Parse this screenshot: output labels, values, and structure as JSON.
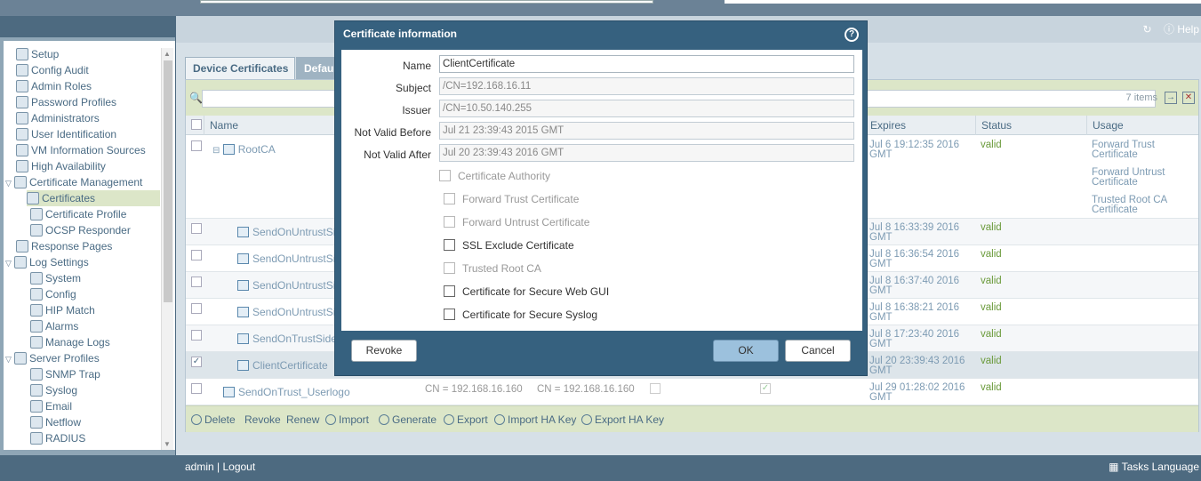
{
  "modal": {
    "title": "Certificate information",
    "fields": [
      {
        "label": "Name",
        "value": "ClientCertificate"
      },
      {
        "label": "Subject",
        "value": "/CN=192.168.16.11"
      },
      {
        "label": "Issuer",
        "value": "/CN=10.50.140.255"
      },
      {
        "label": "Not Valid Before",
        "value": "Jul 21 23:39:43 2015 GMT"
      },
      {
        "label": "Not Valid After",
        "value": "Jul 20 23:39:43 2016 GMT"
      }
    ],
    "checkboxes": [
      "Certificate Authority",
      "Forward Trust Certificate",
      "Forward Untrust Certificate",
      "SSL Exclude Certificate",
      "Trusted Root CA",
      "Certificate for Secure Web GUI",
      "Certificate for Secure Syslog"
    ],
    "revoke_label": "Revoke",
    "ok_label": "OK",
    "cancel_label": "Cancel"
  },
  "header": {
    "help_label": "Help"
  },
  "tabs": {
    "device": "Device Certificates",
    "default": "Defau"
  },
  "grid": {
    "count": "7 items",
    "headers": {
      "name": "Name",
      "expires": "Expires",
      "status": "Status",
      "usage": "Usage"
    },
    "rows": [
      {
        "name": "RootCA",
        "expires": "Jul 6 19:12:35 2016 GMT",
        "status": "valid",
        "usage": "Forward Trust Certificate",
        "usage2": "Forward Untrust Certificate",
        "usage3": "Trusted Root CA Certificate"
      },
      {
        "name": "SendOnUntrustSide",
        "expires": "Jul 8 16:33:39 2016 GMT",
        "status": "valid"
      },
      {
        "name": "SendOnUntrustSide",
        "expires": "Jul 8 16:36:54 2016 GMT",
        "status": "valid"
      },
      {
        "name": "SendOnUntrustSide",
        "expires": "Jul 8 16:37:40 2016 GMT",
        "status": "valid"
      },
      {
        "name": "SendOnUntrustSide",
        "expires": "Jul 8 16:38:21 2016 GMT",
        "status": "valid"
      },
      {
        "name": "SendOnTrustSide_",
        "expires": "Jul 8 17:23:40 2016 GMT",
        "status": "valid"
      },
      {
        "name": "ClientCertificate",
        "expires": "Jul 20 23:39:43 2016 GMT",
        "status": "valid"
      },
      {
        "name": "SendOnTrust_Userlogo",
        "subject": "CN = 192.168.16.160",
        "issuer": "CN = 192.168.16.160",
        "expires": "Jul 29 01:28:02 2016 GMT",
        "status": "valid"
      }
    ],
    "actions": [
      "Delete",
      "Revoke",
      "Renew",
      "Import",
      "Generate",
      "Export",
      "Import HA Key",
      "Export HA Key"
    ]
  },
  "nav": [
    "Setup",
    "Config Audit",
    "Admin Roles",
    "Password Profiles",
    "Administrators",
    "User Identification",
    "VM Information Sources",
    "High Availability",
    "Certificate Management",
    "Certificates",
    "Certificate Profile",
    "OCSP Responder",
    "Response Pages",
    "Log Settings",
    "System",
    "Config",
    "HIP Match",
    "Alarms",
    "Manage Logs",
    "Server Profiles",
    "SNMP Trap",
    "Syslog",
    "Email",
    "Netflow",
    "RADIUS"
  ],
  "footer": {
    "user": "admin",
    "logout": "Logout",
    "tasks": "Tasks",
    "language": "Language"
  }
}
